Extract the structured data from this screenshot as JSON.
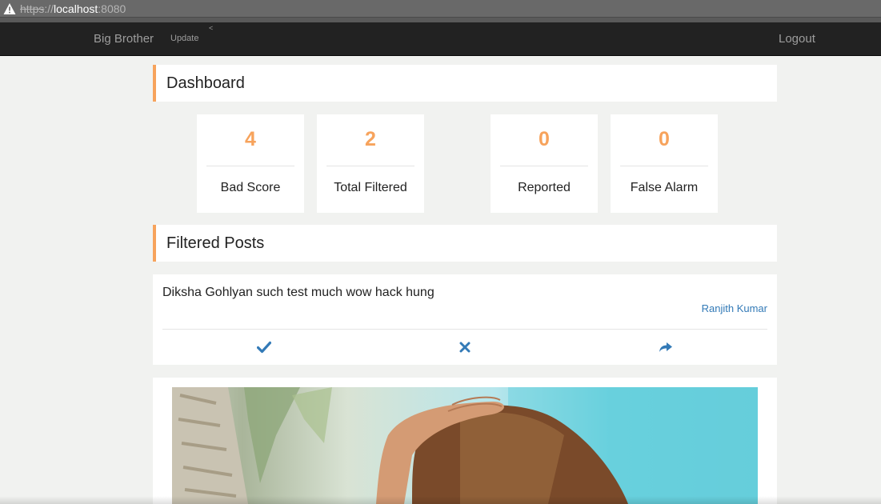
{
  "browser": {
    "url_scheme": "https",
    "url_sep": "://",
    "url_host": "localhost",
    "url_port": ":8080"
  },
  "navbar": {
    "brand": "Big Brother",
    "update_label": "Update",
    "caret": "<",
    "logout_label": "Logout"
  },
  "dashboard": {
    "title": "Dashboard",
    "stats": [
      {
        "value": "4",
        "label": "Bad Score"
      },
      {
        "value": "2",
        "label": "Total Filtered"
      },
      {
        "value": "0",
        "label": "Reported"
      },
      {
        "value": "0",
        "label": "False Alarm"
      }
    ]
  },
  "filtered_posts": {
    "title": "Filtered Posts",
    "posts": [
      {
        "text": "Diksha Gohlyan such test much wow hack hung",
        "author": "Ranjith Kumar",
        "actions": [
          "check-icon",
          "close-icon",
          "share-icon"
        ]
      }
    ]
  },
  "colors": {
    "accent": "#f7a35c",
    "navbar_bg": "#222222",
    "link": "#337ab7",
    "page_bg": "#f1f2f0"
  }
}
